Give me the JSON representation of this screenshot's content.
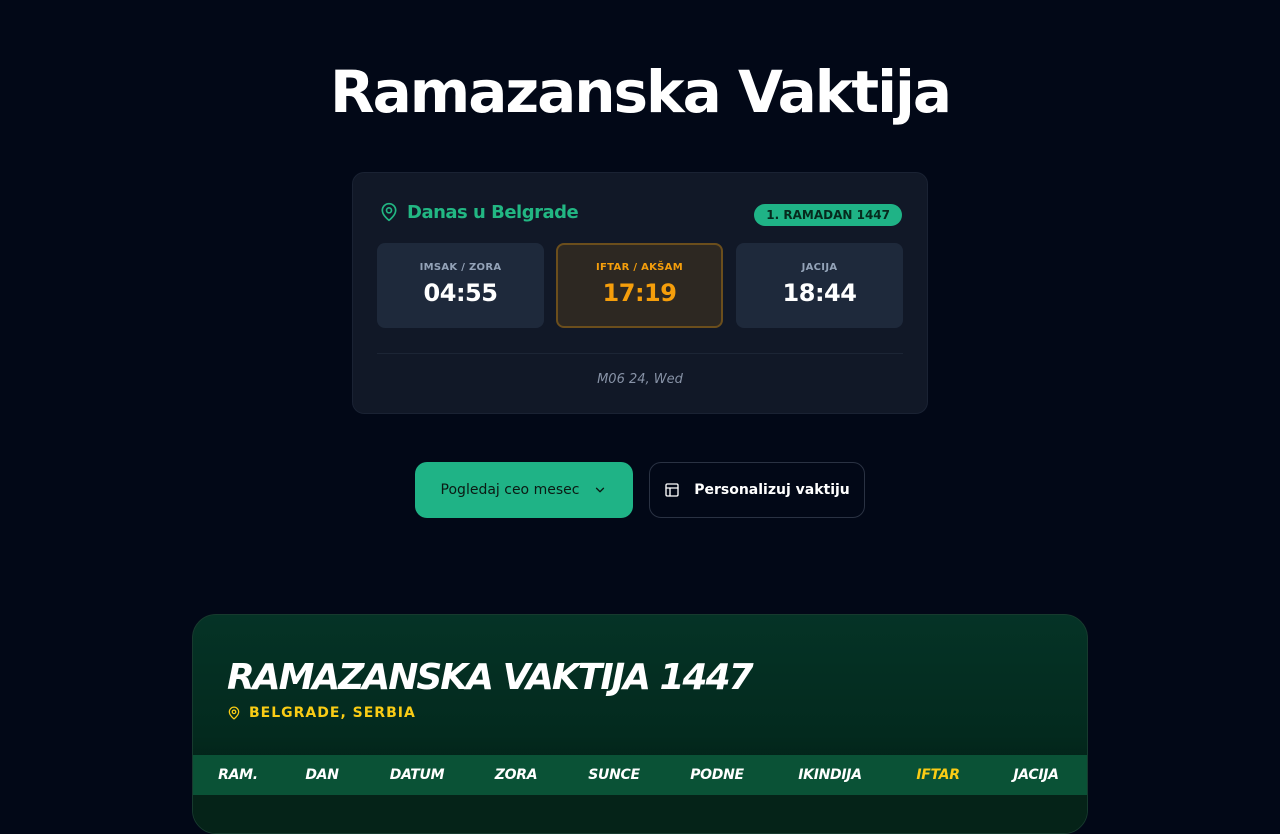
{
  "page_title": "Ramazanska Vaktija",
  "today": {
    "location_label": "Danas u Belgrade",
    "hijri_badge": "1. RAMADAN 1447",
    "times": [
      {
        "label": "IMSAK / ZORA",
        "value": "04:55"
      },
      {
        "label": "IFTAR / AKŠAM",
        "value": "17:19"
      },
      {
        "label": "JACIJA",
        "value": "18:44"
      }
    ],
    "gregorian_date": "M06 24, Wed"
  },
  "actions": {
    "view_month_label": "Pogledaj ceo mesec",
    "customize_label": "Personalizuj vaktiju"
  },
  "month": {
    "title": "RAMAZANSKA VAKTIJA 1447",
    "location": "BELGRADE, SERBIA",
    "columns": [
      "RAM.",
      "DAN",
      "DATUM",
      "ZORA",
      "SUNCE",
      "PODNE",
      "IKINDIJA",
      "IFTAR",
      "JACIJA"
    ]
  },
  "colors": {
    "accent": "#1fb386",
    "iftar": "#f59e0b",
    "highlight": "#facc15",
    "background": "#020817"
  },
  "icons": {
    "location": "map-pin-icon",
    "dropdown": "chevron-down-icon",
    "customize": "layout-icon"
  }
}
